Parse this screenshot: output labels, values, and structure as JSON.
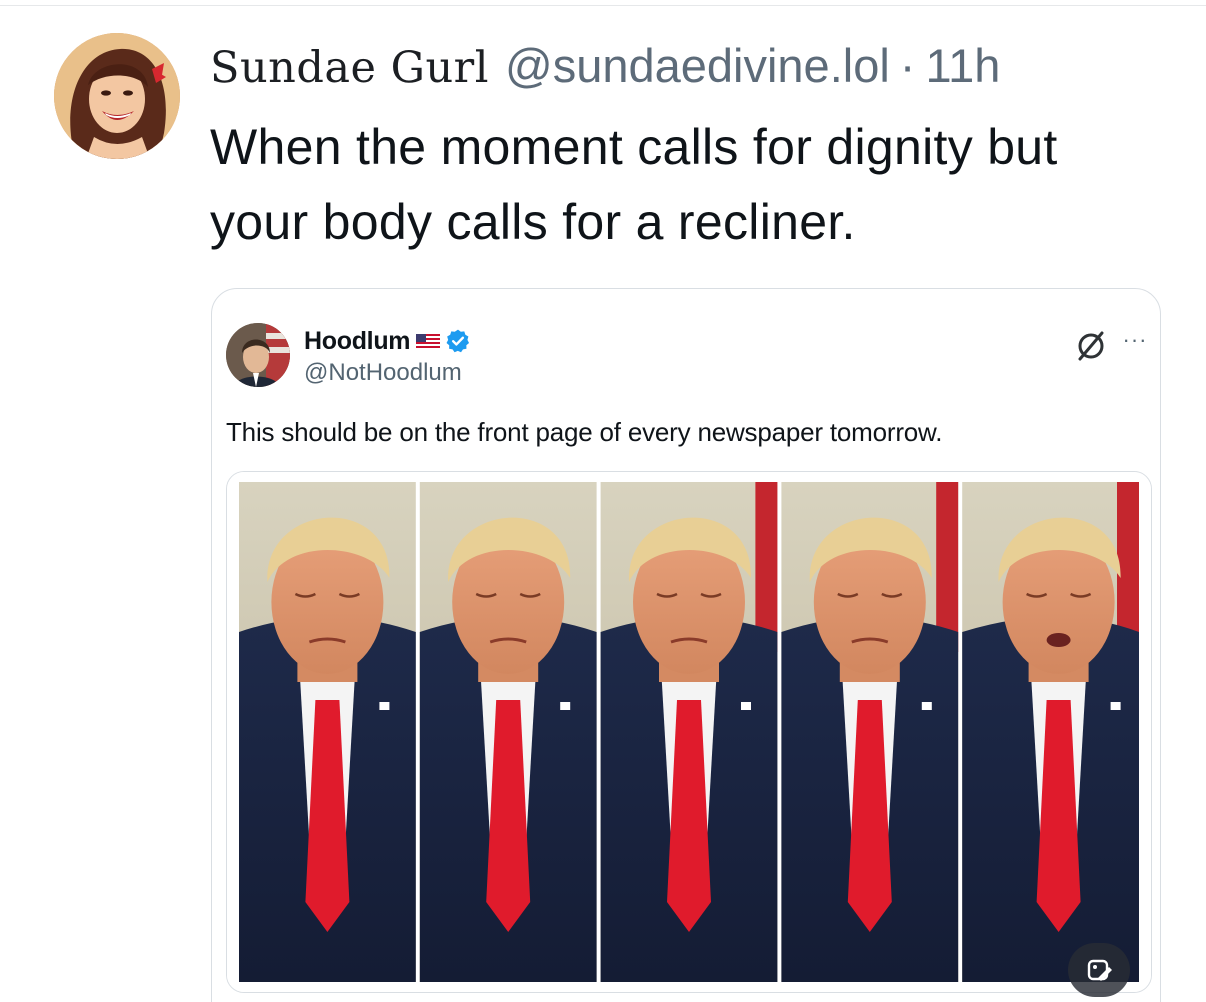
{
  "post": {
    "display_name": "Sundae Gurl",
    "handle": "@sundaedivine.lol",
    "separator": "·",
    "time": "11h",
    "text": "When the moment calls for dignity but your body calls for a recliner."
  },
  "quoted": {
    "display_name": "Hoodlum",
    "handle": "@NotHoodlum",
    "text": "This should be on the front page of every newspaper tomorrow.",
    "verified": true,
    "flag_icon": "us-flag-icon",
    "media_panels": 5
  },
  "icons": {
    "avatar": "avatar",
    "quoted_avatar": "quoted-avatar",
    "verified": "verified-badge-icon",
    "grok": "grok-icon",
    "more": "more-dots-icon",
    "media_badge": "media-edit-icon"
  },
  "colors": {
    "text": "#0f1419",
    "secondary": "#536471",
    "verified": "#1d9bf0",
    "border": "#d9dee3"
  }
}
